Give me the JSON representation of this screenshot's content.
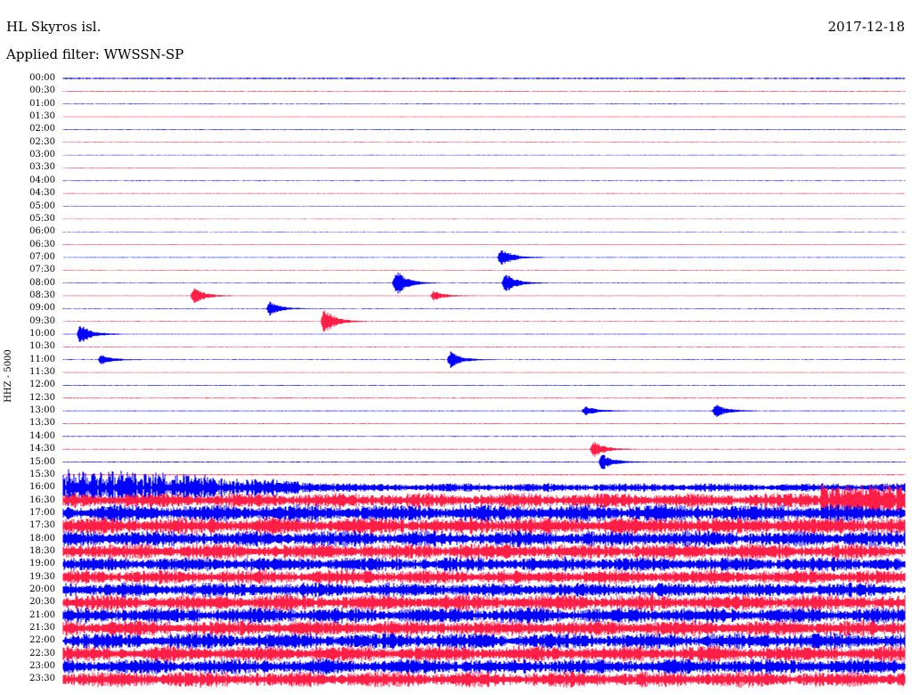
{
  "header": {
    "station": "HL Skyros isl.",
    "filter": "Applied filter: WWSSN-SP",
    "date": "2017-12-18"
  },
  "chart_data": {
    "type": "line",
    "ylabel": "HHZ - 5000",
    "row_labels": [
      "00:00",
      "00:30",
      "01:00",
      "01:30",
      "02:00",
      "02:30",
      "03:00",
      "03:30",
      "04:00",
      "04:30",
      "05:00",
      "05:30",
      "06:00",
      "06:30",
      "07:00",
      "07:30",
      "08:00",
      "08:30",
      "09:00",
      "09:30",
      "10:00",
      "10:30",
      "11:00",
      "11:30",
      "12:00",
      "12:30",
      "13:00",
      "13:30",
      "14:00",
      "14:30",
      "15:00",
      "15:30",
      "16:00",
      "16:30",
      "17:00",
      "17:30",
      "18:00",
      "18:30",
      "19:00",
      "19:30",
      "20:00",
      "20:30",
      "21:00",
      "21:30",
      "22:00",
      "22:30",
      "23:00",
      "23:30"
    ],
    "colors": [
      "#0000ff",
      "#ff1e46"
    ],
    "row_noise_level": [
      0.6,
      0.35,
      0.3,
      0.3,
      0.35,
      0.3,
      0.25,
      0.3,
      0.3,
      0.3,
      0.25,
      0.25,
      0.25,
      0.3,
      0.3,
      0.3,
      0.3,
      0.3,
      0.3,
      0.3,
      0.3,
      0.3,
      0.3,
      0.3,
      0.35,
      0.35,
      0.35,
      0.35,
      0.35,
      0.35,
      0.4,
      0.45,
      3.0,
      5.0,
      6.0,
      6.0,
      5.5,
      5.5,
      5.0,
      5.0,
      5.0,
      5.5,
      5.5,
      5.5,
      5.5,
      5.5,
      5.5,
      5.5
    ],
    "events": [
      {
        "row": 14,
        "x": 0.52,
        "amp": 12
      },
      {
        "row": 16,
        "x": 0.395,
        "amp": 16
      },
      {
        "row": 16,
        "x": 0.525,
        "amp": 12
      },
      {
        "row": 17,
        "x": 0.155,
        "amp": 10
      },
      {
        "row": 17,
        "x": 0.44,
        "amp": 6
      },
      {
        "row": 18,
        "x": 0.245,
        "amp": 8
      },
      {
        "row": 19,
        "x": 0.31,
        "amp": 16
      },
      {
        "row": 20,
        "x": 0.02,
        "amp": 12
      },
      {
        "row": 22,
        "x": 0.045,
        "amp": 6
      },
      {
        "row": 22,
        "x": 0.46,
        "amp": 10
      },
      {
        "row": 26,
        "x": 0.62,
        "amp": 6
      },
      {
        "row": 26,
        "x": 0.775,
        "amp": 8
      },
      {
        "row": 29,
        "x": 0.63,
        "amp": 10
      },
      {
        "row": 30,
        "x": 0.64,
        "amp": 10
      }
    ]
  }
}
